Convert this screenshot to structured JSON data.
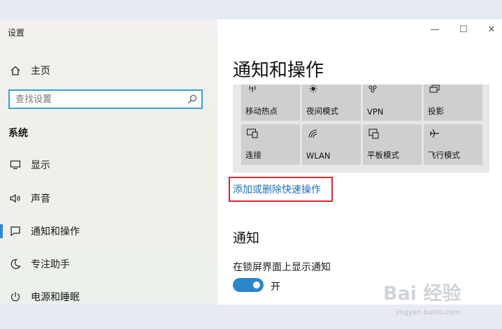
{
  "app": {
    "title": "设置"
  },
  "sidebar": {
    "home_label": "主页",
    "search": {
      "placeholder": "查找设置"
    },
    "section_title": "系统",
    "items": [
      {
        "label": "显示",
        "icon": "monitor-icon"
      },
      {
        "label": "声音",
        "icon": "speaker-icon"
      },
      {
        "label": "通知和操作",
        "icon": "notification-icon",
        "active": true
      },
      {
        "label": "专注助手",
        "icon": "moon-icon"
      },
      {
        "label": "电源和睡眠",
        "icon": "power-icon"
      }
    ]
  },
  "window_controls": {
    "minimize": "—",
    "maximize": "☐",
    "close": "✕"
  },
  "main": {
    "title": "通知和操作",
    "quick_actions": [
      {
        "label": "移动热点",
        "icon": "hotspot-icon"
      },
      {
        "label": "夜间模式",
        "icon": "brightness-icon"
      },
      {
        "label": "VPN",
        "icon": "vpn-icon"
      },
      {
        "label": "投影",
        "icon": "project-icon"
      },
      {
        "label": "连接",
        "icon": "connect-icon"
      },
      {
        "label": "WLAN",
        "icon": "wifi-icon"
      },
      {
        "label": "平板模式",
        "icon": "tablet-mode-icon"
      },
      {
        "label": "飞行模式",
        "icon": "airplane-icon"
      }
    ],
    "edit_quick_actions_link": "添加或删除快速操作",
    "notifications_title": "通知",
    "lock_screen_notify_label": "在锁屏界面上显示通知",
    "lock_screen_toggle": {
      "state": "开",
      "on": true
    }
  },
  "watermark": {
    "logo": "Bai 经验",
    "url": "jingyan.baidu.com"
  },
  "colors": {
    "accent": "#2a87c8",
    "link": "#1d6fb8",
    "highlight_box": "#d9272e",
    "tile": "#cfcfcf"
  }
}
